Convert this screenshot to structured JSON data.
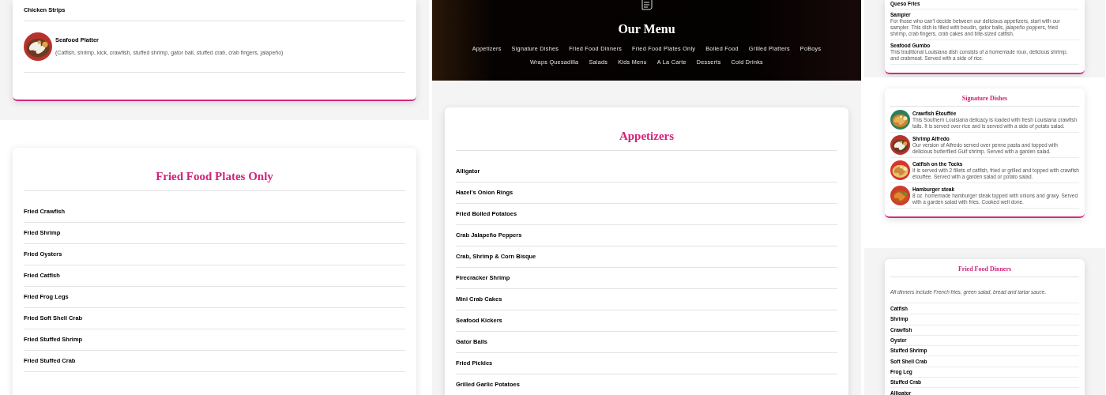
{
  "left_column": {
    "top_card": {
      "items": [
        {
          "kind": "plain",
          "name": "Chicken Strips"
        },
        {
          "kind": "with_picture",
          "name": "Seafood Platter",
          "description": "(Catfish, shrimp, kick, crawfish, stuffed shrimp, gator ball, stuffed crab, crab fingers, jalapeño)"
        }
      ]
    },
    "bottom_card": {
      "title": "Fried Food Plates Only",
      "items": [
        {
          "kind": "plain",
          "name": "Fried Crawfish"
        },
        {
          "kind": "plain",
          "name": "Fried Shrimp"
        },
        {
          "kind": "plain",
          "name": "Fried Oysters"
        },
        {
          "kind": "plain",
          "name": "Fried Catfish"
        },
        {
          "kind": "plain",
          "name": "Fried Frog Legs"
        },
        {
          "kind": "plain",
          "name": "Fried Soft Shell Crab"
        },
        {
          "kind": "plain",
          "name": "Fried Stuffed Shrimp"
        },
        {
          "kind": "plain",
          "name": "Fried Stuffed Crab"
        }
      ]
    }
  },
  "center_column": {
    "hero": {
      "title": "Our Menu",
      "nav_rows": [
        [
          "Appetizers",
          "Signature Dishes",
          "Fried Food Dinners",
          "Fried Food Plates Only",
          "Boiled Food",
          "Grilled Platters",
          "PoBoys"
        ],
        [
          "Wraps Quesadilla",
          "Salads",
          "Kids Menu",
          "A La Carte",
          "Desserts",
          "Cold Drinks"
        ]
      ]
    },
    "card": {
      "title": "Appetizers",
      "items": [
        {
          "kind": "plain",
          "name": "Alligator"
        },
        {
          "kind": "plain",
          "name": "Hazel's Onion Rings"
        },
        {
          "kind": "plain",
          "name": "Fried Boiled Potatoes"
        },
        {
          "kind": "plain",
          "name": "Crab Jalapeño Peppers"
        },
        {
          "kind": "plain",
          "name": "Crab, Shrimp & Corn Bisque"
        },
        {
          "kind": "plain",
          "name": "Firecracker Shrimp"
        },
        {
          "kind": "plain",
          "name": "Mini Crab Cakes"
        },
        {
          "kind": "plain",
          "name": "Seafood Kickers"
        },
        {
          "kind": "plain",
          "name": "Gator Balls"
        },
        {
          "kind": "plain",
          "name": "Fried Pickles"
        },
        {
          "kind": "plain",
          "name": "Grilled Garlic Potatoes"
        }
      ]
    }
  },
  "right_column": {
    "top_card": {
      "items": [
        {
          "kind": "plain",
          "name": "Queso Fries"
        },
        {
          "kind": "described",
          "name": "Sampler",
          "description": "For those who can't decide between our delicious appetizers, start with our sampler. This dish is filled with boudin, gator balls, jalapeño poppers, fried shrimp, crab fingers, crab cakes and bite-sized catfish."
        },
        {
          "kind": "described",
          "name": "Seafood Gumbo",
          "description": "This traditional Louisiana dish consists of a homemade roux, delicious shrimp, and crabmeat. Served with a side of rice."
        }
      ]
    },
    "middle_card": {
      "title": "Signature Dishes",
      "items": [
        {
          "kind": "with_picture",
          "name": "Crawfish Étouffée",
          "description": "This Southern Louisiana delicacy is loaded with fresh Louisiana crawfish tails. It is served over rice and is served with a side of potato salad."
        },
        {
          "kind": "with_picture",
          "name": "Shrimp Alfredo",
          "description": "Our version of Alfredo served over penne pasta and topped with delicious butterflied Gulf shrimp. Served with a garden salad."
        },
        {
          "kind": "with_picture",
          "name": "Catfish on the Tocks",
          "description": "It is served with 2 fillets of catfish, fried or grilled and topped with crawfish étouffée. Served with a garden salad or potato salad."
        },
        {
          "kind": "with_picture",
          "name": "Hamburger steak",
          "description": "8 oz. homemade hamburger steak topped with onions and gravy. Served with a garden salad with fries. Cooked well done."
        }
      ]
    },
    "bottom_card": {
      "title": "Fried Food Dinners",
      "note": "All dinners include French fries, green salad, bread and tartar sauce.",
      "items": [
        {
          "kind": "plain",
          "name": "Catfish"
        },
        {
          "kind": "plain",
          "name": "Shrimp"
        },
        {
          "kind": "plain",
          "name": "Crawfish"
        },
        {
          "kind": "plain",
          "name": "Oyster"
        },
        {
          "kind": "plain",
          "name": "Stuffed Shrimp"
        },
        {
          "kind": "plain",
          "name": "Soft Shell Crab"
        },
        {
          "kind": "plain",
          "name": "Frog Leg"
        },
        {
          "kind": "plain",
          "name": "Stuffed Crab"
        },
        {
          "kind": "plain",
          "name": "Alligator"
        }
      ]
    }
  }
}
